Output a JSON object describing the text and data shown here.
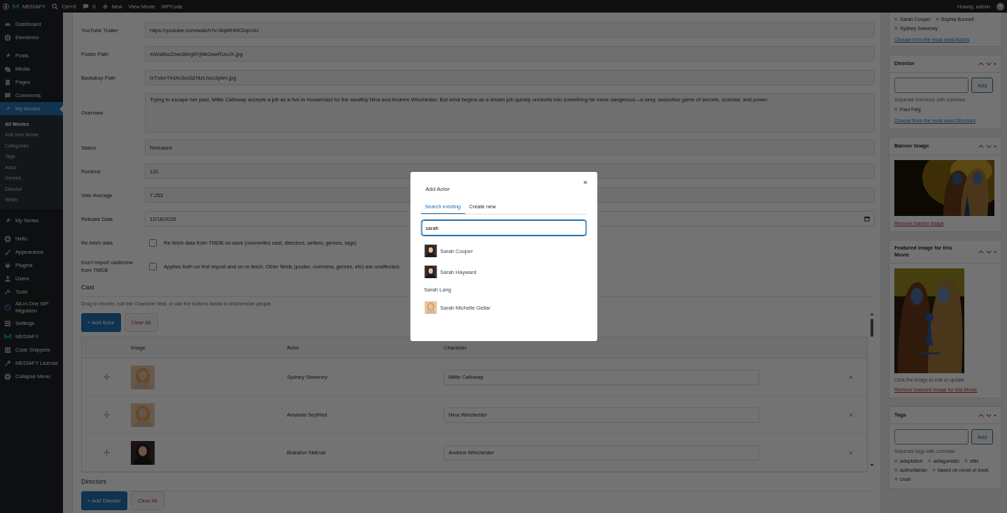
{
  "admin_bar": {
    "site": "MEDIAFY",
    "search": "Ctrl+K",
    "comments": "0",
    "new": "New",
    "links": [
      "View Movie",
      "WPCode"
    ],
    "greeting": "Howdy, admin"
  },
  "menu": [
    {
      "label": "Dashboard",
      "selected": false
    },
    {
      "label": "Elementor",
      "selected": false
    },
    {
      "label": "Posts",
      "selected": false
    },
    {
      "label": "Media",
      "selected": false
    },
    {
      "label": "Pages",
      "selected": false
    },
    {
      "label": "Comments",
      "selected": false
    },
    {
      "label": "My Movies",
      "selected": true,
      "submenu": [
        {
          "label": "All Movies",
          "selected": true
        },
        {
          "label": "Add new Movie",
          "selected": false
        },
        {
          "label": "Categories",
          "selected": false
        },
        {
          "label": "Tags",
          "selected": false
        },
        {
          "label": "Actor",
          "selected": false
        },
        {
          "label": "Genres",
          "selected": false
        },
        {
          "label": "Director",
          "selected": false
        },
        {
          "label": "Writer",
          "selected": false
        }
      ]
    },
    {
      "label": "My Series",
      "selected": false
    },
    {
      "label": "Hello",
      "selected": false
    },
    {
      "label": "Appearance",
      "selected": false
    },
    {
      "label": "Plugins",
      "selected": false
    },
    {
      "label": "Users",
      "selected": false
    },
    {
      "label": "Tools",
      "selected": false
    },
    {
      "label": "All-in-One WP Migration",
      "selected": false
    },
    {
      "label": "Settings",
      "selected": false
    },
    {
      "label": "MEDIAFY",
      "selected": false
    },
    {
      "label": "Code Snippets",
      "selected": false
    },
    {
      "label": "MEDIAFY License",
      "selected": false
    },
    {
      "label": "Collapse Menu",
      "selected": false
    }
  ],
  "fields": [
    {
      "label": "YouTube Trailer",
      "kind": "text",
      "value": "https://youtube.com/watch?v=BqWH0KDqm3U"
    },
    {
      "label": "Poster Path",
      "kind": "text",
      "value": "/cWsBscZzwu5brg9YjNkGewRUvJX.jpg"
    },
    {
      "label": "Backdrop Path",
      "kind": "text",
      "value": "/zTnAnYIn0lv3cn0ZHlzLhou3ybm.jpg"
    },
    {
      "label": "Overview",
      "kind": "textarea",
      "value": "Trying to escape her past, Millie Calloway accepts a job as a live-in housemaid for the wealthy Nina and Andrew Winchester. But what begins as a dream job quickly unravels into something far more dangerous—a sexy, seductive game of secrets, scandal, and power."
    },
    {
      "label": "Status",
      "kind": "text",
      "value": "Released"
    },
    {
      "label": "Runtime",
      "kind": "text",
      "value": "131"
    },
    {
      "label": "Vote Average",
      "kind": "text",
      "value": "7.253"
    },
    {
      "label": "Release Date",
      "kind": "date",
      "value": "12/18/2025"
    },
    {
      "label": "Re-fetch data",
      "kind": "checkbox",
      "checked": false,
      "text": "Re-fetch data from TMDB on save (overwrites cast, directors, writers, genres, tags)"
    },
    {
      "label": "Don't import cast/crew from TMDB",
      "kind": "checkbox",
      "checked": false,
      "text": "Applies both on first import and on re-fetch. Other fields (poster, overview, genres, etc) are unaffected."
    }
  ],
  "cast": {
    "title": "Cast",
    "hint": "Drag to reorder, edit the Character field, or use the buttons below to add/remove people.",
    "add_button": "+ Add Actor",
    "clear_button": "Clear All",
    "columns": [
      "Image",
      "Actor",
      "Character"
    ],
    "rows": [
      {
        "actor": "Sydney Sweeney",
        "character": "Millie Calloway"
      },
      {
        "actor": "Amanda Seyfried",
        "character": "Nina Winchester"
      },
      {
        "actor": "Brandon Sklenar",
        "character": "Andrew Winchester"
      }
    ]
  },
  "directors": {
    "title": "Directors",
    "add_button": "+ Add Director",
    "clear_button": "Clear All"
  },
  "actors_box": {
    "tags": [
      "Sarah Cooper",
      "Sophia Bunnell",
      "Sydney Sweeney"
    ],
    "link": "Choose from the most used Actors"
  },
  "director_box": {
    "title": "Director",
    "button": "Add",
    "hint": "Separate Directors with commas",
    "tags": [
      "Paul Feig"
    ],
    "link": "Choose from the most used Directors"
  },
  "banner_box": {
    "title": "Banner Image",
    "link": "Remove banner image"
  },
  "featured_box": {
    "title": "Featured image for this Movie",
    "hint": "Click the image to edit or update",
    "link": "Remove featured image for this Movie"
  },
  "tags_box": {
    "title": "Tags",
    "button": "Add",
    "hint": "Separate tags with commas",
    "tags": [
      "adaptation",
      "antagonistic",
      "attic",
      "authoritarian",
      "based on novel or book",
      "cruel"
    ]
  },
  "modal": {
    "title": "Add Actor",
    "tabs": [
      {
        "label": "Search existing",
        "selected": true
      },
      {
        "label": "Create new",
        "selected": false
      }
    ],
    "query": "sarah",
    "results": [
      {
        "name": "Sarah Cooper",
        "photo": true
      },
      {
        "name": "Sarah Hayward",
        "photo": true
      },
      {
        "name": "Sarah Lang",
        "photo": false
      },
      {
        "name": "Sarah Michelle Gellar",
        "photo": true
      }
    ]
  }
}
